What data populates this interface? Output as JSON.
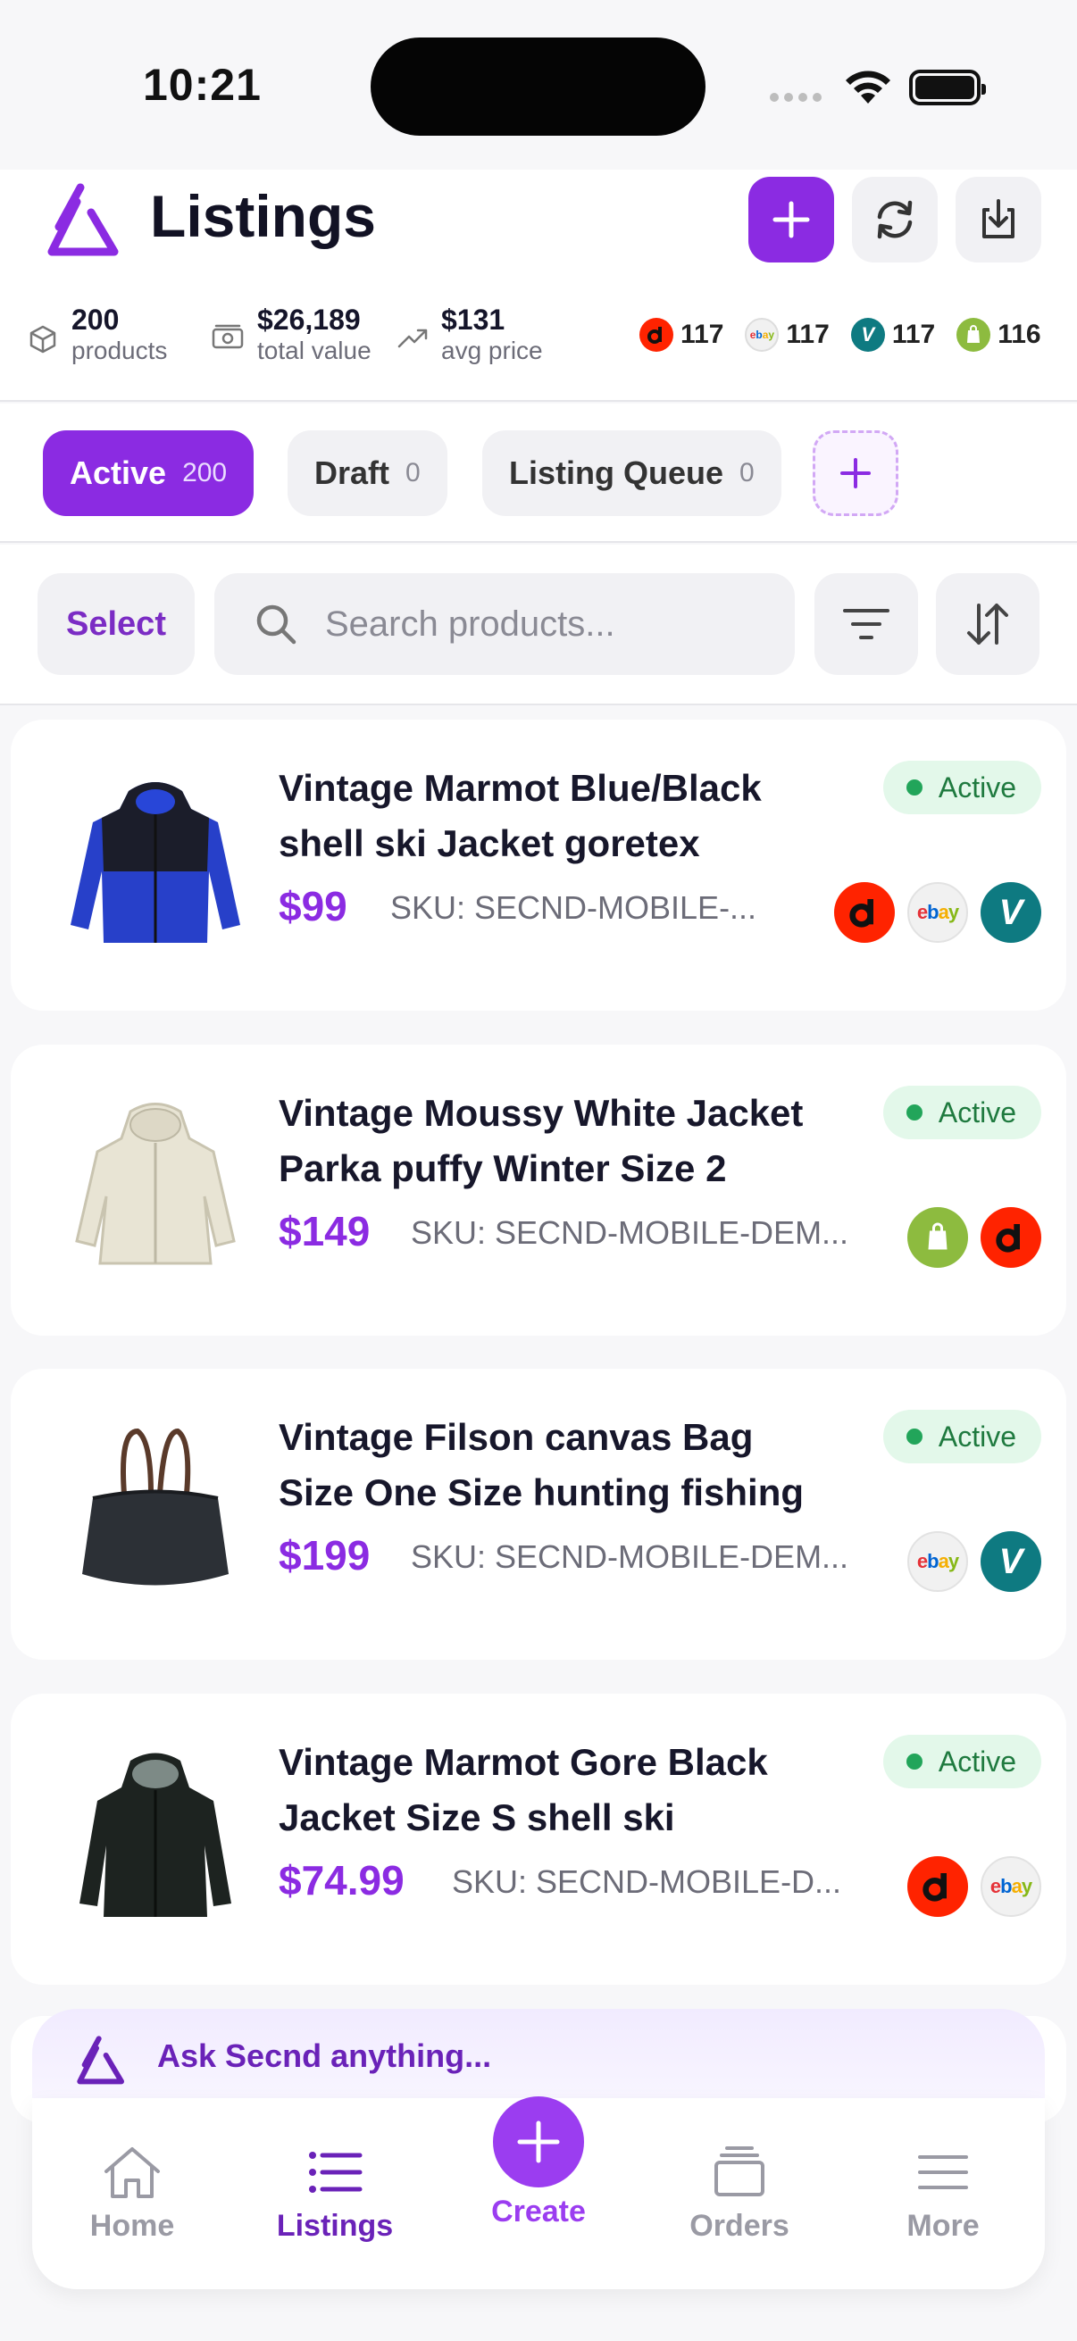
{
  "status_bar": {
    "time": "10:21"
  },
  "header": {
    "title": "Listings",
    "stats": [
      {
        "value": "200",
        "label": "products",
        "icon": "box-icon"
      },
      {
        "value": "$26,189",
        "label": "total value",
        "icon": "cash-icon"
      },
      {
        "value": "$131",
        "label": "avg price",
        "icon": "trend-icon"
      }
    ],
    "channel_counts": [
      {
        "channel": "depop",
        "count": "117",
        "color": "#ff2300"
      },
      {
        "channel": "ebay",
        "count": "117",
        "color": "#f1f1f1"
      },
      {
        "channel": "vinted",
        "count": "117",
        "color": "#0e7a81"
      },
      {
        "channel": "shopify",
        "count": "116",
        "color": "#8dbb3f"
      }
    ]
  },
  "tabs": [
    {
      "label": "Active",
      "count": "200"
    },
    {
      "label": "Draft",
      "count": "0"
    },
    {
      "label": "Listing Queue",
      "count": "0"
    }
  ],
  "toolbar": {
    "select_label": "Select",
    "search_placeholder": "Search products..."
  },
  "products": [
    {
      "title": "Vintage Marmot Blue/Black shell ski Jacket goretex",
      "price": "$99",
      "sku": "SKU: SECND-MOBILE-...",
      "status": "Active",
      "channels": [
        "depop",
        "ebay",
        "vinted"
      ]
    },
    {
      "title": "Vintage Moussy White Jacket Parka puffy Winter Size 2",
      "price": "$149",
      "sku": "SKU: SECND-MOBILE-DEM...",
      "status": "Active",
      "channels": [
        "shopify",
        "depop"
      ]
    },
    {
      "title": "Vintage  Filson canvas Bag Size One Size hunting fishing",
      "price": "$199",
      "sku": "SKU: SECND-MOBILE-DEM...",
      "status": "Active",
      "channels": [
        "ebay",
        "vinted"
      ]
    },
    {
      "title": "Vintage  Marmot Gore Black Jacket Size S shell ski",
      "price": "$74.99",
      "sku": "SKU: SECND-MOBILE-D...",
      "status": "Active",
      "channels": [
        "depop",
        "ebay"
      ]
    }
  ],
  "assistant": {
    "prompt": "Ask Secnd anything..."
  },
  "nav": [
    {
      "label": "Home"
    },
    {
      "label": "Listings"
    },
    {
      "label": "Create"
    },
    {
      "label": "Orders"
    },
    {
      "label": "More"
    }
  ],
  "channel_labels": {
    "ebay": "ebay",
    "vinted": "V",
    "depop": "d"
  },
  "colors": {
    "accent": "#8b2be2",
    "status_active_bg": "#e3f8ea",
    "status_active_dot": "#22a55a"
  }
}
